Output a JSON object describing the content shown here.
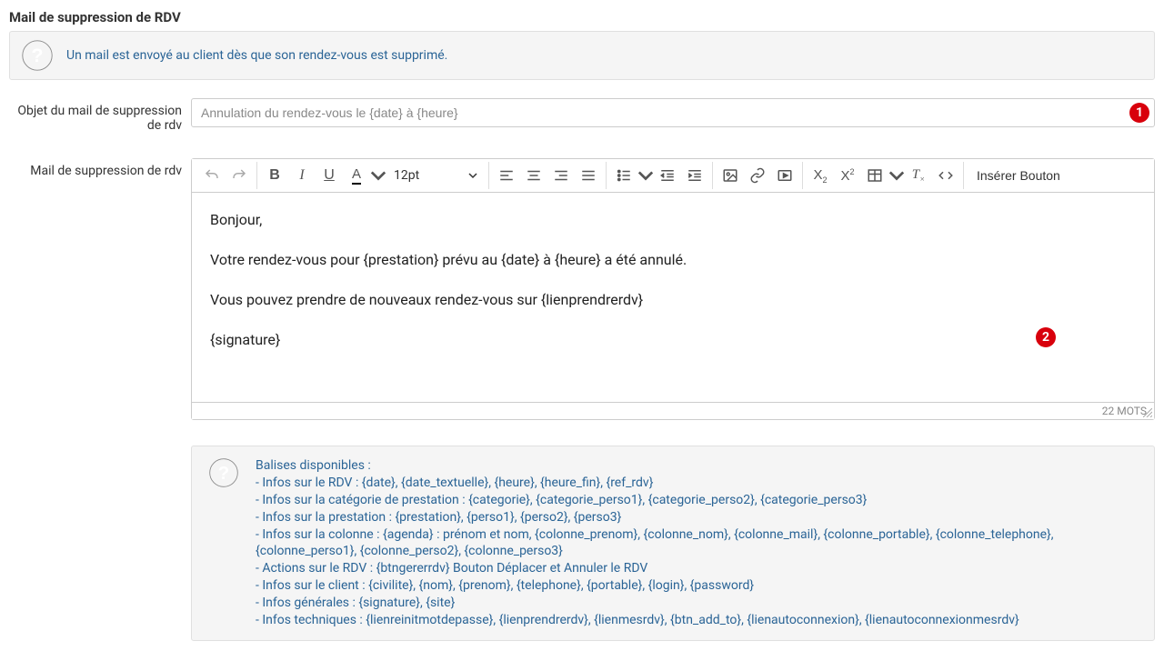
{
  "section_title": "Mail de suppression de RDV",
  "top_info": "Un mail est envoyé au client dès que son rendez-vous est supprimé.",
  "labels": {
    "subject": "Objet du mail de suppression de rdv",
    "body": "Mail de suppression de rdv"
  },
  "subject_value": "Annulation du rendez-vous le {date} à {heure}",
  "badges": {
    "one": "1",
    "two": "2"
  },
  "toolbar": {
    "fontsize": "12pt",
    "insert_button": "Insérer Bouton"
  },
  "editor_content": {
    "p1": "Bonjour,",
    "p2": "Votre rendez-vous pour {prestation} prévu au {date} à {heure} a été annulé.",
    "p3": "Vous pouvez prendre de nouveaux rendez-vous sur {lienprendrerdv}",
    "p4": "{signature}"
  },
  "word_count": "22 MOTS",
  "tags": {
    "title": "Balises disponibles :",
    "lines": [
      "- Infos sur le RDV : {date}, {date_textuelle}, {heure}, {heure_fin}, {ref_rdv}",
      "- Infos sur la catégorie de prestation : {categorie}, {categorie_perso1}, {categorie_perso2}, {categorie_perso3}",
      "- Infos sur la prestation : {prestation}, {perso1}, {perso2}, {perso3}",
      "- Infos sur la colonne : {agenda} : prénom et nom, {colonne_prenom}, {colonne_nom}, {colonne_mail}, {colonne_portable}, {colonne_telephone}, {colonne_perso1}, {colonne_perso2}, {colonne_perso3}",
      "- Actions sur le RDV : {btngererrdv} Bouton Déplacer et Annuler le RDV",
      "- Infos sur le client : {civilite}, {nom}, {prenom}, {telephone}, {portable}, {login}, {password}",
      "- Infos générales : {signature}, {site}",
      "- Infos techniques : {lienreinitmotdepasse}, {lienprendrerdv}, {lienmesrdv}, {btn_add_to}, {lienautoconnexion}, {lienautoconnexionmesrdv}"
    ]
  }
}
